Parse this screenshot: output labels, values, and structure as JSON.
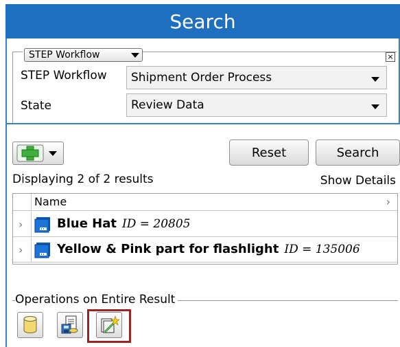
{
  "header": {
    "title": "Search"
  },
  "criteria": {
    "type_selector": "STEP Workflow",
    "workflow_label": "STEP Workflow",
    "workflow_value": "Shipment Order Process",
    "state_label": "State",
    "state_value": "Review Data",
    "close_glyph": "×"
  },
  "toolbar": {
    "reset_label": "Reset",
    "search_label": "Search"
  },
  "results": {
    "summary": "Displaying 2 of 2 results",
    "show_details": "Show Details",
    "column_name": "Name",
    "rows": [
      {
        "name": "Blue Hat",
        "id": "ID = 20805"
      },
      {
        "name": "Yellow & Pink part for flashlight",
        "id": "ID = 135006"
      }
    ]
  },
  "operations": {
    "label": "Operations on Entire Result"
  },
  "icons": {
    "add": "plus-icon",
    "row": "product-icon",
    "op1": "database-icon",
    "op2": "export-icon",
    "op3": "magic-wand-icon"
  },
  "colors": {
    "header": "#1e6fc0",
    "highlight": "#9b2526",
    "add_green": "#3fae3a"
  }
}
